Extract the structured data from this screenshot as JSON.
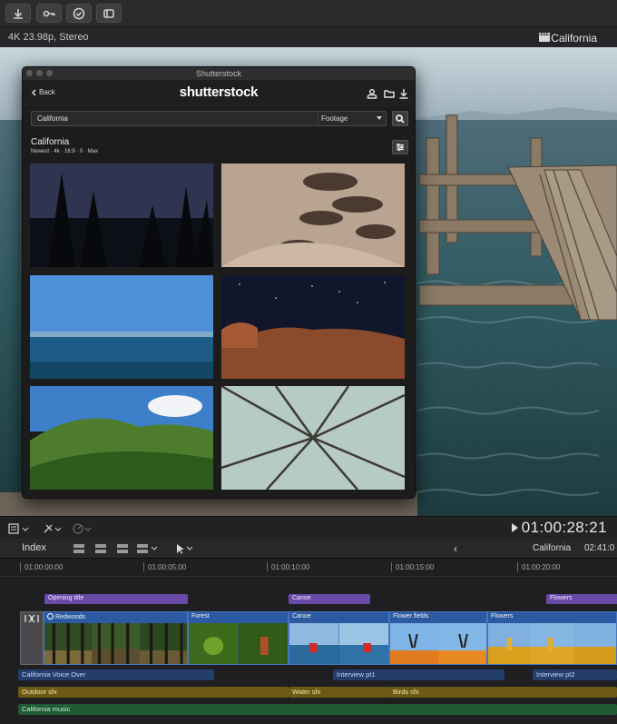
{
  "toolbar": {
    "buttons": [
      "import-icon",
      "keyword-icon",
      "check-icon",
      "transitions-icon"
    ]
  },
  "infobar": {
    "format": "4K 23.98p, Stereo",
    "project": "California"
  },
  "shutterstock": {
    "window_title": "Shutterstock",
    "back_label": "Back",
    "logo": "shutterstock",
    "search_value": "California",
    "media_type": "Footage",
    "results_title": "California",
    "results_subtitle": "Newest · 4k · 16:9 · 0 · Max",
    "thumbnails": [
      "redwood-night",
      "sand-dunes",
      "ocean-horizon",
      "starry-desert",
      "green-hills",
      "tree-canopy"
    ]
  },
  "timeline_controls": {
    "timecode": "01:00:28:21"
  },
  "timeline_header": {
    "index_label": "Index",
    "project": "California",
    "duration": "02:41:0"
  },
  "ruler": [
    "01:00:00:00",
    "01:00:05:00",
    "01:00:10:00",
    "01:00:15:00",
    "01:00:20:00"
  ],
  "titles": [
    "Opening title",
    "Canoe",
    "Flowers"
  ],
  "video_clips": [
    "Redwoods",
    "Forest",
    "Canoe",
    "Flower fields",
    "Flowers"
  ],
  "voice_clips": [
    "California Voice Over",
    "Interview pt1",
    "Interview pt2"
  ],
  "sfx_clips": [
    "Outdoor sfx",
    "Water sfx",
    "Birds sfx"
  ],
  "music_clip": "California music",
  "colors": {
    "title_clip": "#6a4aa8",
    "video_clip": "#2b5aa3",
    "voice_clip": "#233e6b",
    "sfx_clip": "#6d5a16",
    "music_clip": "#1f5b33"
  }
}
